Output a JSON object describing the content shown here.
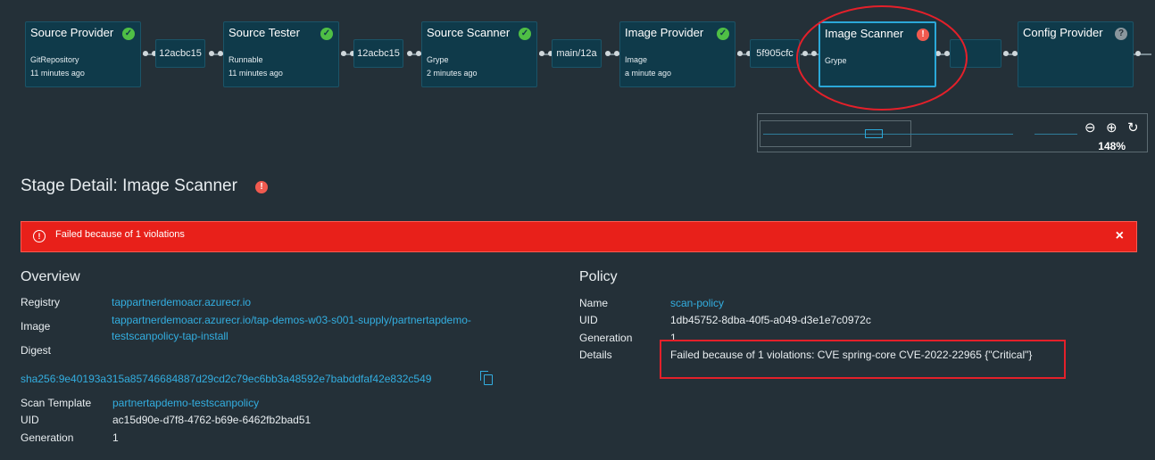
{
  "pipeline": {
    "nodes": [
      {
        "title": "Source Provider",
        "line1": "GitRepository",
        "line2": "11 minutes ago",
        "status": "success"
      },
      {
        "title": "Source Tester",
        "line1": "Runnable",
        "line2": "11 minutes ago",
        "status": "success"
      },
      {
        "title": "Source Scanner",
        "line1": "Grype",
        "line2": "2 minutes ago",
        "status": "success"
      },
      {
        "title": "Image Provider",
        "line1": "Image",
        "line2": "a minute ago",
        "status": "success"
      },
      {
        "title": "Image Scanner",
        "line1": "Grype",
        "line2": "",
        "status": "error"
      },
      {
        "title": "Config Provider",
        "line1": "",
        "line2": "",
        "status": "unknown"
      }
    ],
    "chips": [
      "12acbc15",
      "12acbc15",
      "main/12a",
      "5f905cfc",
      ""
    ]
  },
  "zoom": {
    "level": "148%",
    "zoom_out_icon": "zoom-out-icon",
    "zoom_in_icon": "zoom-in-icon",
    "reset_icon": "reset-icon"
  },
  "stage": {
    "title": "Stage Detail: Image Scanner"
  },
  "alert": {
    "message": "Failed because of 1 violations",
    "close": "×"
  },
  "overview": {
    "title": "Overview",
    "registry_label": "Registry",
    "registry_value": "tappartnerdemoacr.azurecr.io",
    "image_label": "Image",
    "image_value_line1": "tappartnerdemoacr.azurecr.io/tap-demos-w03-s001-supply/partnertapdemo-",
    "image_value_line2": "testscanpolicy-tap-install",
    "digest_label": "Digest",
    "digest_value": "sha256:9e40193a315a85746684887d29cd2c79ec6bb3a48592e7babddfaf42e832c549",
    "scan_template_label": "Scan Template",
    "scan_template_value": "partnertapdemo-testscanpolicy",
    "uid_label": "UID",
    "uid_value": "ac15d90e-d7f8-4762-b69e-6462fb2bad51",
    "generation_label": "Generation",
    "generation_value": "1"
  },
  "policy": {
    "title": "Policy",
    "name_label": "Name",
    "name_value": "scan-policy",
    "uid_label": "UID",
    "uid_value": "1db45752-8dba-40f5-a049-d3e1e7c0972c",
    "generation_label": "Generation",
    "generation_value": "1",
    "details_label": "Details",
    "details_value": "Failed because of 1 violations: CVE spring-core CVE-2022-22965 {\"Critical\"}"
  },
  "colors": {
    "background": "#243038",
    "node": "#0f3a4a",
    "accent": "#2ba8d8",
    "link": "#33aee0",
    "error": "#e8201a",
    "success": "#4fbf45"
  }
}
